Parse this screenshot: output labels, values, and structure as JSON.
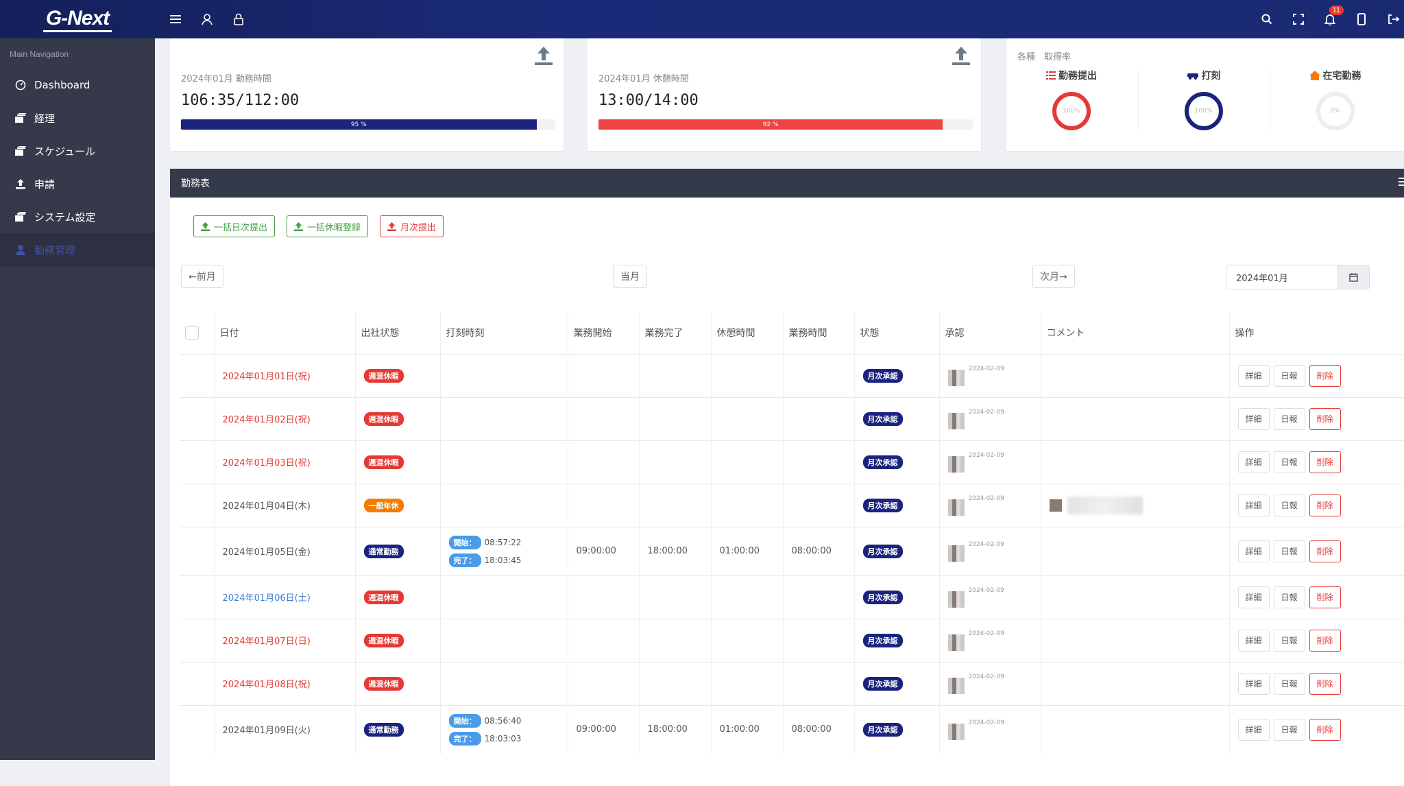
{
  "header": {
    "logo": "G-Next",
    "notification_count": "11"
  },
  "sidebar": {
    "title": "Main Navigation",
    "items": [
      {
        "label": "Dashboard",
        "icon": "dashboard-icon"
      },
      {
        "label": "経理",
        "icon": "stack-icon"
      },
      {
        "label": "スケジュール",
        "icon": "stack-icon"
      },
      {
        "label": "申請",
        "icon": "upload-icon"
      },
      {
        "label": "システム設定",
        "icon": "stack-icon"
      },
      {
        "label": "勤務管理",
        "icon": "user-icon"
      }
    ]
  },
  "stats": [
    {
      "label": "2024年01月 勤務時間",
      "value": "106:35/112:00",
      "percent_label": "95 %",
      "percent": 95,
      "color": "#1a237e"
    },
    {
      "label": "2024年01月 休憩時間",
      "value": "13:00/14:00",
      "percent_label": "92 %",
      "percent": 92,
      "color": "#ef4444"
    }
  ],
  "rates": {
    "title": "各種　取得率",
    "items": [
      {
        "name": "勤務提出",
        "value": "100%",
        "percent": 100,
        "color": "#e53935",
        "icon": "list-icon"
      },
      {
        "name": "打刻",
        "value": "100%",
        "percent": 100,
        "color": "#1a237e",
        "icon": "car-icon"
      },
      {
        "name": "在宅勤務",
        "value": "0%",
        "percent": 0,
        "color": "#f57c00",
        "icon": "home-icon"
      }
    ]
  },
  "panel": {
    "title": "勤務表"
  },
  "actions": {
    "bulk_daily": "一括日次提出",
    "bulk_leave": "一括休暇登録",
    "monthly": "月次提出"
  },
  "nav": {
    "prev": "←前月",
    "current": "当月",
    "next": "次月→",
    "month_value": "2024年01月"
  },
  "table": {
    "headers": [
      "日付",
      "出社状態",
      "打刻時刻",
      "業務開始",
      "業務完了",
      "休憩時間",
      "業務時間",
      "状態",
      "承認",
      "コメント",
      "操作"
    ],
    "op_detail": "詳細",
    "op_report": "日報",
    "op_delete": "削除",
    "rows": [
      {
        "date": "2024年01月01日(祝)",
        "date_color": "red",
        "status": "週混休暇",
        "status_color": "red",
        "start_label": "",
        "start": "",
        "end_label": "",
        "end": "",
        "work_start": "",
        "work_end": "",
        "break": "",
        "work": "",
        "state": "月次承認",
        "appr_date": "2024-02-09",
        "comment": false
      },
      {
        "date": "2024年01月02日(祝)",
        "date_color": "red",
        "status": "週混休暇",
        "status_color": "red",
        "start_label": "",
        "start": "",
        "end_label": "",
        "end": "",
        "work_start": "",
        "work_end": "",
        "break": "",
        "work": "",
        "state": "月次承認",
        "appr_date": "2024-02-09",
        "comment": false
      },
      {
        "date": "2024年01月03日(祝)",
        "date_color": "red",
        "status": "週混休暇",
        "status_color": "red",
        "start_label": "",
        "start": "",
        "end_label": "",
        "end": "",
        "work_start": "",
        "work_end": "",
        "break": "",
        "work": "",
        "state": "月次承認",
        "appr_date": "2024-02-09",
        "comment": false
      },
      {
        "date": "2024年01月04日(木)",
        "date_color": "normal",
        "status": "一般年休",
        "status_color": "orange",
        "start_label": "",
        "start": "",
        "end_label": "",
        "end": "",
        "work_start": "",
        "work_end": "",
        "break": "",
        "work": "",
        "state": "月次承認",
        "appr_date": "2024-02-09",
        "comment": true
      },
      {
        "date": "2024年01月05日(金)",
        "date_color": "normal",
        "status": "通常勤務",
        "status_color": "navy",
        "start_label": "開始：",
        "start": "08:57:22",
        "end_label": "完了：",
        "end": "18:03:45",
        "work_start": "09:00:00",
        "work_end": "18:00:00",
        "break": "01:00:00",
        "work": "08:00:00",
        "state": "月次承認",
        "appr_date": "2024-02-09",
        "comment": false
      },
      {
        "date": "2024年01月06日(土)",
        "date_color": "blue",
        "status": "週混休暇",
        "status_color": "red",
        "start_label": "",
        "start": "",
        "end_label": "",
        "end": "",
        "work_start": "",
        "work_end": "",
        "break": "",
        "work": "",
        "state": "月次承認",
        "appr_date": "2024-02-09",
        "comment": false
      },
      {
        "date": "2024年01月07日(日)",
        "date_color": "red",
        "status": "週混休暇",
        "status_color": "red",
        "start_label": "",
        "start": "",
        "end_label": "",
        "end": "",
        "work_start": "",
        "work_end": "",
        "break": "",
        "work": "",
        "state": "月次承認",
        "appr_date": "2024-02-09",
        "comment": false
      },
      {
        "date": "2024年01月08日(祝)",
        "date_color": "red",
        "status": "週混休暇",
        "status_color": "red",
        "start_label": "",
        "start": "",
        "end_label": "",
        "end": "",
        "work_start": "",
        "work_end": "",
        "break": "",
        "work": "",
        "state": "月次承認",
        "appr_date": "2024-02-09",
        "comment": false
      },
      {
        "date": "2024年01月09日(火)",
        "date_color": "normal",
        "status": "通常勤務",
        "status_color": "navy",
        "start_label": "開始：",
        "start": "08:56:40",
        "end_label": "完了：",
        "end": "18:03:03",
        "work_start": "09:00:00",
        "work_end": "18:00:00",
        "break": "01:00:00",
        "work": "08:00:00",
        "state": "月次承認",
        "appr_date": "2024-02-09",
        "comment": false
      }
    ]
  }
}
